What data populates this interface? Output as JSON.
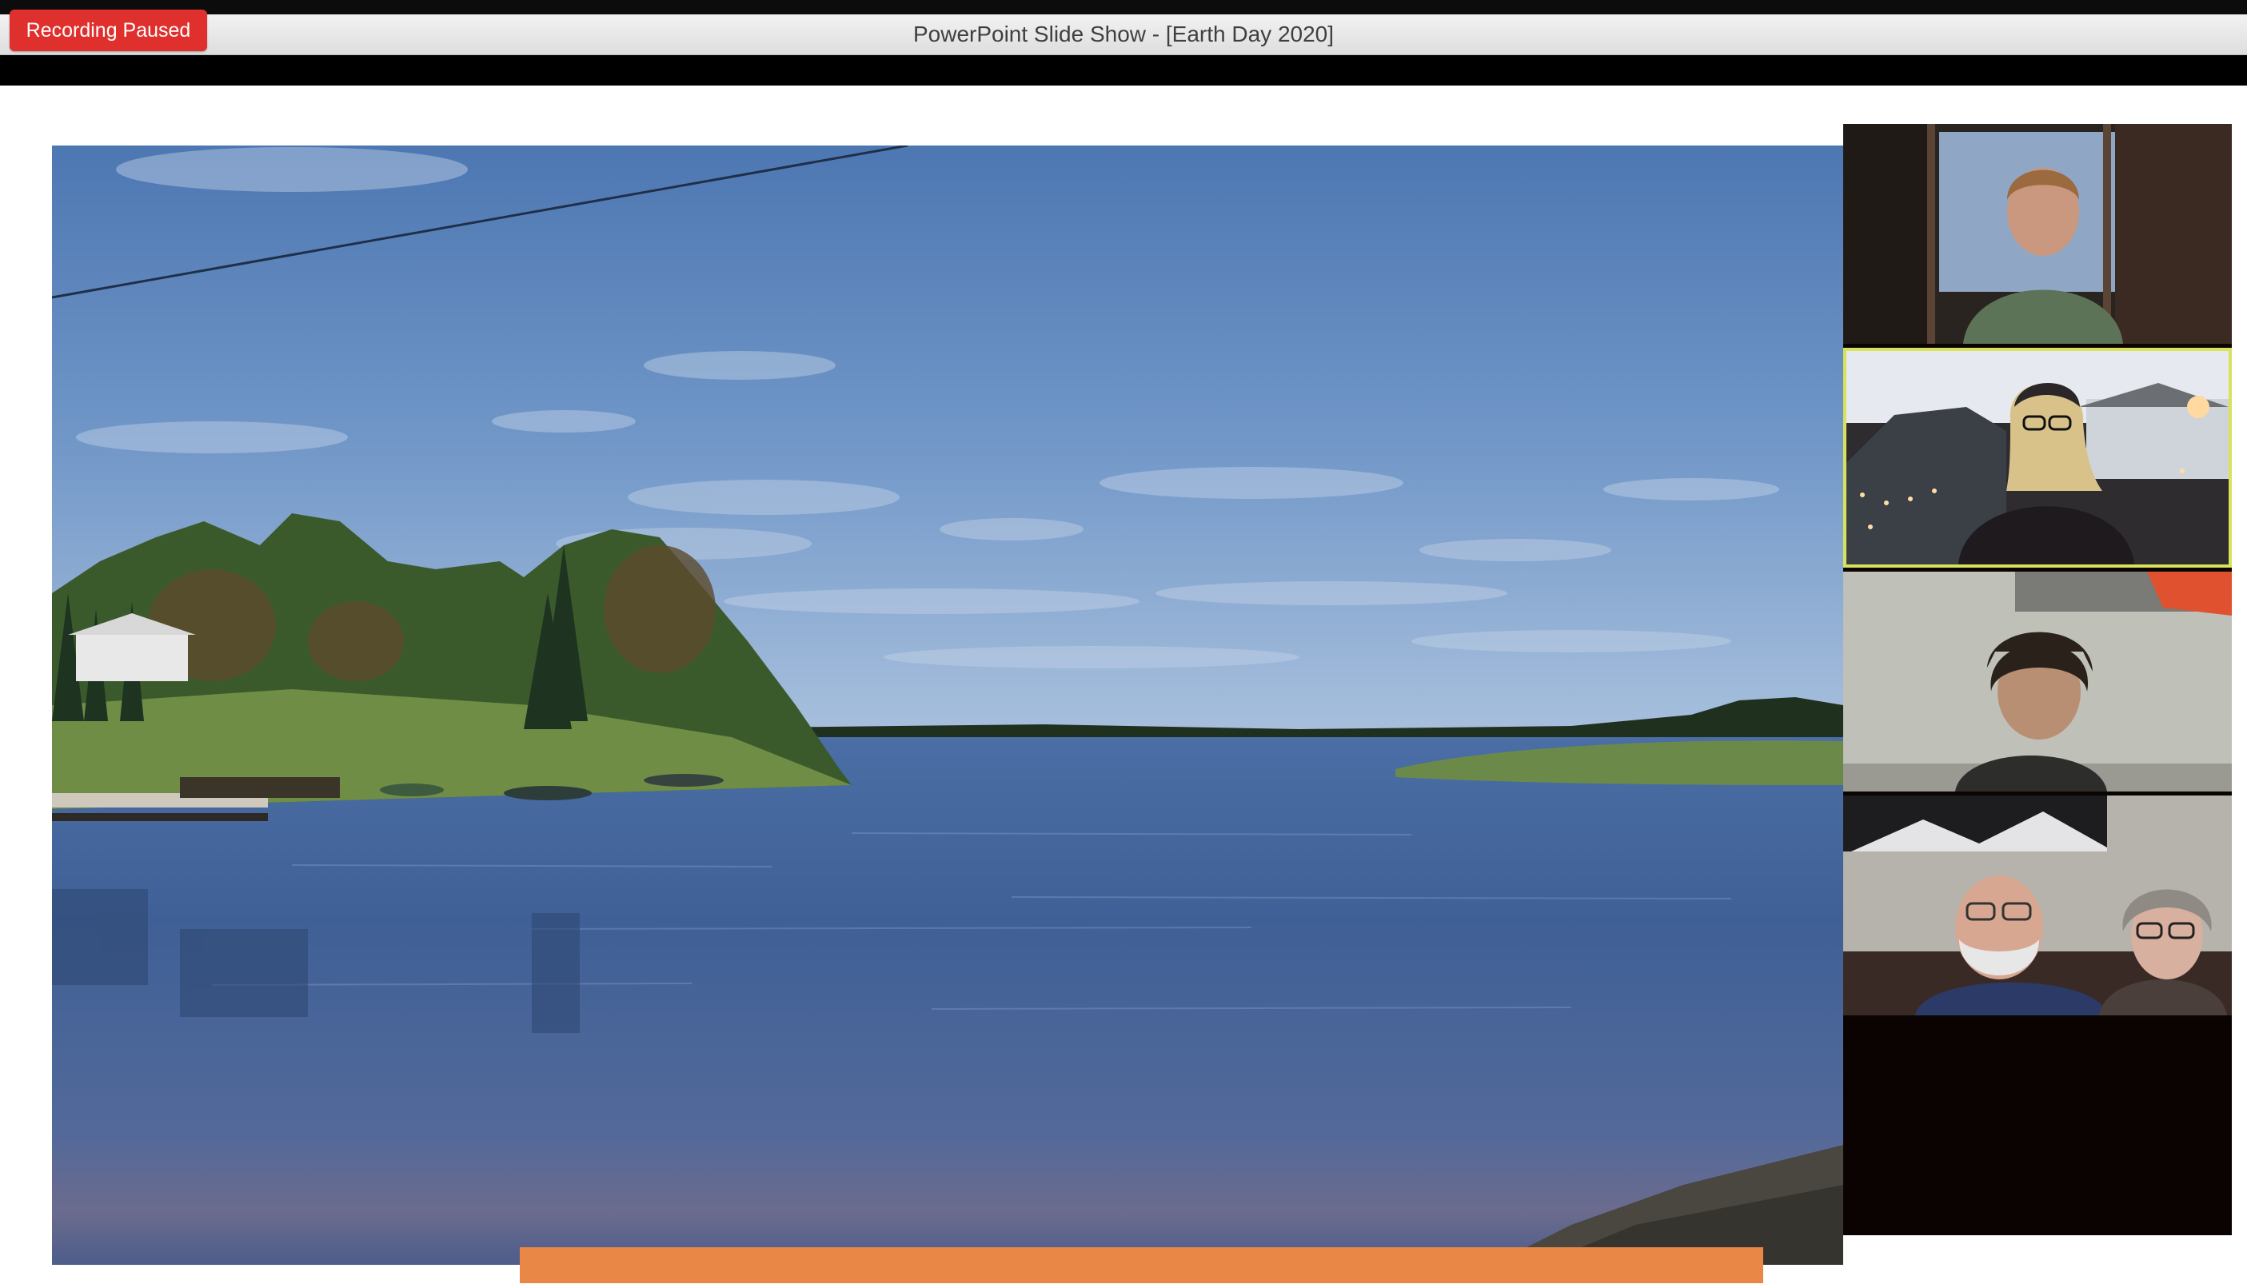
{
  "window": {
    "title": "PowerPoint Slide Show - [Earth Day 2020]"
  },
  "recording": {
    "status_label": "Recording Paused"
  },
  "slide": {
    "image": "river-landscape-photo",
    "accent_color": "#e98746"
  },
  "gallery": {
    "participants": [
      {
        "tile": "participant-1",
        "active": false
      },
      {
        "tile": "participant-2",
        "active": true
      },
      {
        "tile": "participant-3",
        "active": false
      },
      {
        "tile": "participant-4",
        "active": false
      }
    ],
    "active_speaker_color": "#d8e35b"
  },
  "colors": {
    "recording_badge": "#e0302d",
    "title_bar": "#e8e8e8"
  }
}
